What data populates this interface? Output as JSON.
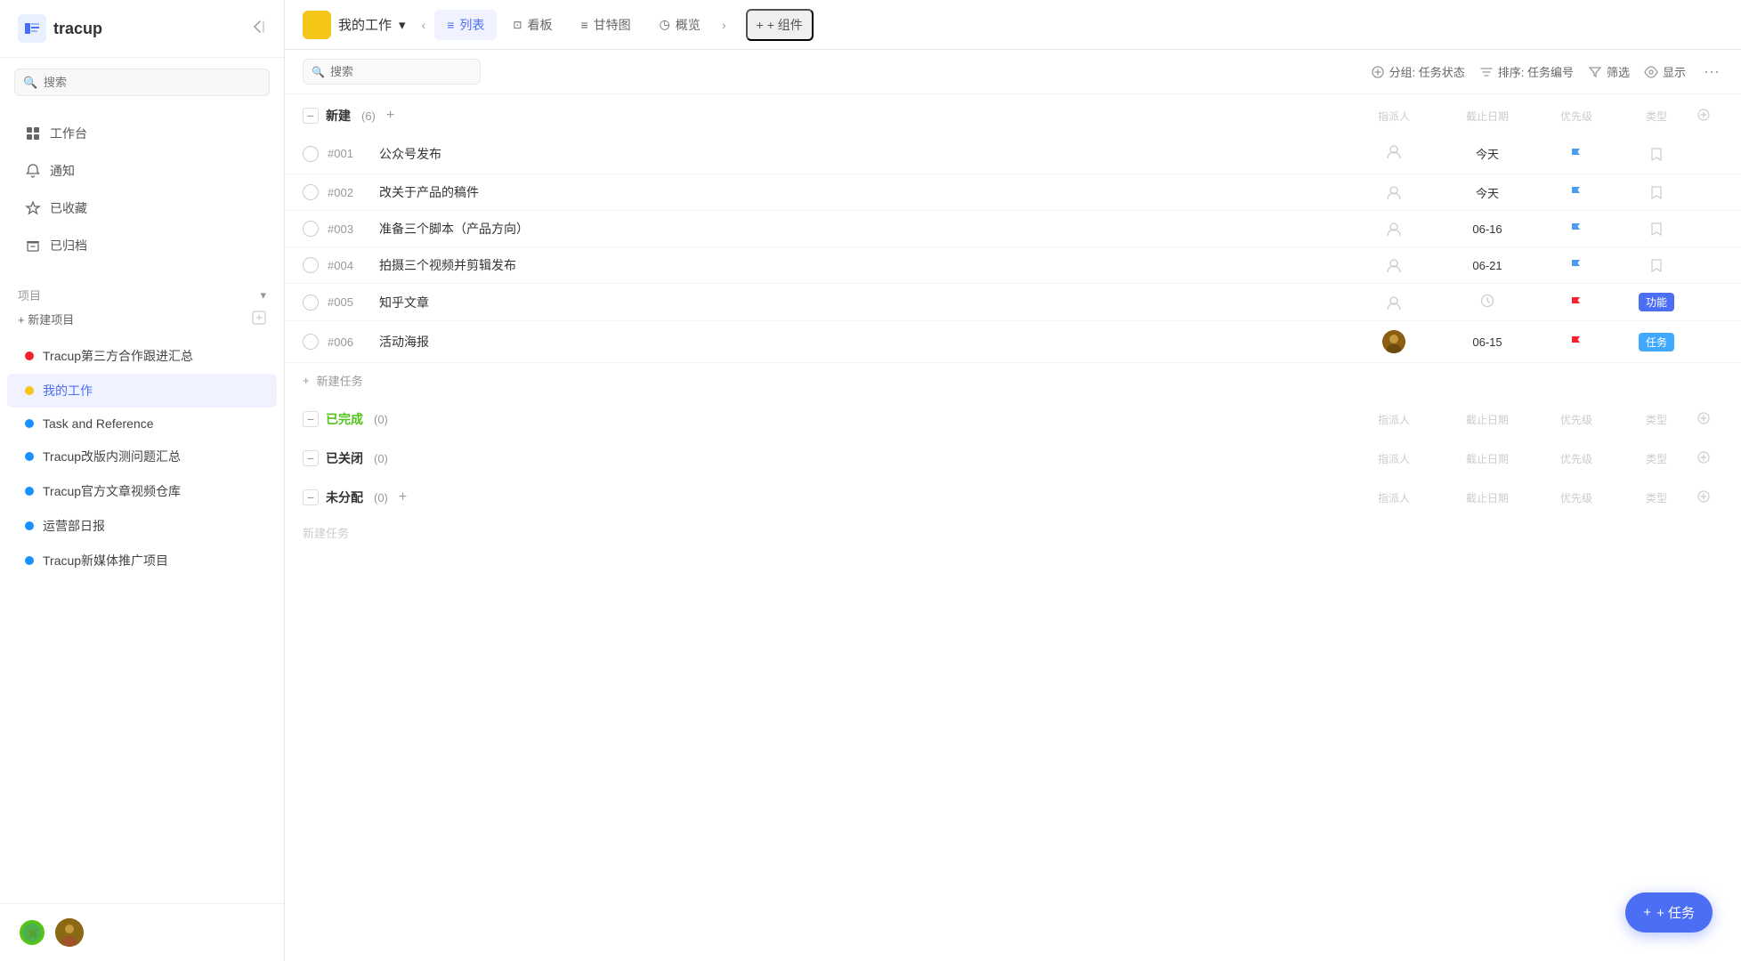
{
  "app": {
    "name": "tracup"
  },
  "sidebar": {
    "search_placeholder": "搜索",
    "collapse_icon": "◁=",
    "nav_items": [
      {
        "id": "workspace",
        "label": "工作台",
        "icon": "⊞"
      },
      {
        "id": "notifications",
        "label": "通知",
        "icon": "🔔"
      },
      {
        "id": "favorites",
        "label": "已收藏",
        "icon": "☆"
      },
      {
        "id": "archived",
        "label": "已归档",
        "icon": "⊡"
      }
    ],
    "projects_section": {
      "title": "项目",
      "add_label": "+ 新建项目",
      "import_icon": "⊡"
    },
    "projects": [
      {
        "id": "p1",
        "label": "Tracup第三方合作跟进汇总",
        "color": "#f5222d",
        "active": false
      },
      {
        "id": "p2",
        "label": "我的工作",
        "color": "#f5c518",
        "active": true
      },
      {
        "id": "p3",
        "label": "Task and Reference",
        "color": "#1890ff",
        "active": false
      },
      {
        "id": "p4",
        "label": "Tracup改版内测问题汇总",
        "color": "#1890ff",
        "active": false
      },
      {
        "id": "p5",
        "label": "Tracup官方文章视频仓库",
        "color": "#1890ff",
        "active": false
      },
      {
        "id": "p6",
        "label": "运营部日报",
        "color": "#1890ff",
        "active": false
      },
      {
        "id": "p7",
        "label": "Tracup新媒体推广项目",
        "color": "#1890ff",
        "active": false
      }
    ],
    "footer_avatars": [
      "avatar1",
      "avatar2"
    ]
  },
  "topbar": {
    "workspace_color": "#f5c518",
    "workspace_title": "我的工作",
    "dropdown_icon": "▾",
    "tabs": [
      {
        "id": "list",
        "label": "列表",
        "icon": "≡",
        "active": true
      },
      {
        "id": "kanban",
        "label": "看板",
        "icon": "⊡",
        "active": false
      },
      {
        "id": "gantt",
        "label": "甘特图",
        "icon": "≡",
        "active": false
      },
      {
        "id": "overview",
        "label": "概览",
        "icon": "◷",
        "active": false
      }
    ],
    "more_icon": ">",
    "add_component": "+ 组件"
  },
  "toolbar": {
    "search_placeholder": "搜索",
    "group_label": "分组: 任务状态",
    "sort_label": "排序: 任务编号",
    "filter_label": "筛选",
    "display_label": "显示",
    "more_icon": "···"
  },
  "sections": [
    {
      "id": "new",
      "name": "新建",
      "count": 6,
      "status": "new",
      "col_assignee": "指派人",
      "col_due": "截止日期",
      "col_priority": "优先级",
      "col_type": "类型",
      "tasks": [
        {
          "id": "#001",
          "title": "公众号发布",
          "assignee": null,
          "due": "今天",
          "priority": "blue",
          "type": null
        },
        {
          "id": "#002",
          "title": "改关于产品的稿件",
          "assignee": null,
          "due": "今天",
          "priority": "blue",
          "type": null
        },
        {
          "id": "#003",
          "title": "准备三个脚本（产品方向）",
          "assignee": null,
          "due": "06-16",
          "priority": "blue",
          "type": null
        },
        {
          "id": "#004",
          "title": "拍摄三个视频并剪辑发布",
          "assignee": null,
          "due": "06-21",
          "priority": "blue",
          "type": null
        },
        {
          "id": "#005",
          "title": "知乎文章",
          "assignee": null,
          "due": null,
          "priority": "red",
          "type": "功能"
        },
        {
          "id": "#006",
          "title": "活动海报",
          "assignee": "avatar",
          "due": "06-15",
          "priority": "red",
          "type": "任务"
        }
      ],
      "add_task_label": "+ 新建任务"
    },
    {
      "id": "completed",
      "name": "已完成",
      "count": 0,
      "status": "completed",
      "col_assignee": "指派人",
      "col_due": "截止日期",
      "col_priority": "优先级",
      "col_type": "类型",
      "tasks": []
    },
    {
      "id": "closed",
      "name": "已关闭",
      "count": 0,
      "status": "closed",
      "col_assignee": "指派人",
      "col_due": "截止日期",
      "col_priority": "优先级",
      "col_type": "类型",
      "tasks": []
    },
    {
      "id": "unassigned",
      "name": "未分配",
      "count": 0,
      "status": "unassigned",
      "col_assignee": "指派人",
      "col_due": "截止日期",
      "col_priority": "优先级",
      "col_type": "类型",
      "tasks": [],
      "add_task_label": "新建任务"
    }
  ],
  "fab": {
    "label": "+ 任务"
  },
  "colors": {
    "accent": "#4c6ef5",
    "success": "#52c41a",
    "danger": "#f5222d",
    "warning": "#f5c518",
    "blue_flag": "#4c9bef",
    "red_flag": "#f5222d"
  }
}
